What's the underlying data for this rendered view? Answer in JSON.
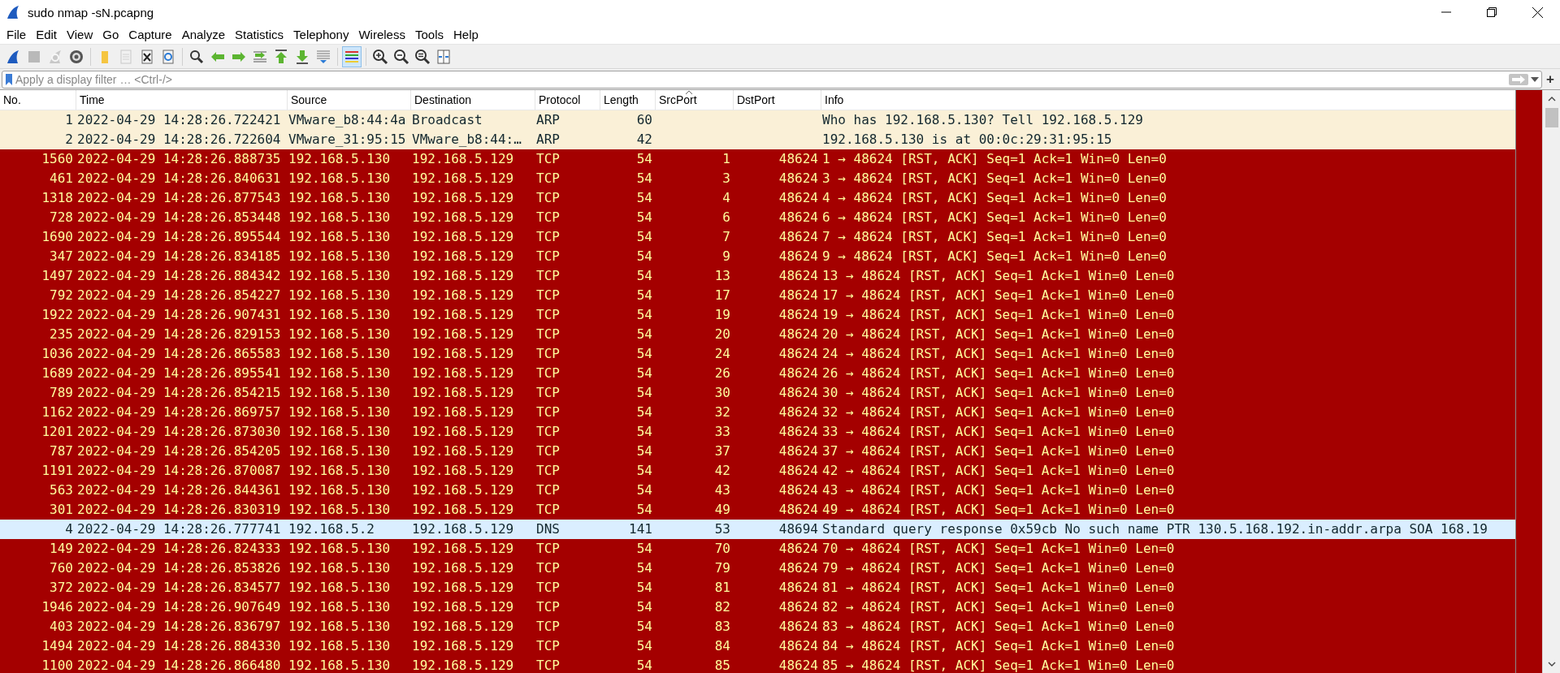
{
  "window": {
    "title": "sudo nmap -sN.pcapng"
  },
  "menu": [
    "File",
    "Edit",
    "View",
    "Go",
    "Capture",
    "Analyze",
    "Statistics",
    "Telephony",
    "Wireless",
    "Tools",
    "Help"
  ],
  "toolbar": [
    {
      "kind": "start",
      "disabled": false,
      "pressed": false
    },
    {
      "kind": "stop",
      "disabled": true,
      "pressed": false
    },
    {
      "kind": "restart",
      "disabled": true,
      "pressed": false
    },
    {
      "kind": "options",
      "disabled": false,
      "pressed": false
    },
    {
      "kind": "separator"
    },
    {
      "kind": "open",
      "disabled": false,
      "pressed": false
    },
    {
      "kind": "save",
      "disabled": true,
      "pressed": false
    },
    {
      "kind": "close",
      "disabled": false,
      "pressed": false
    },
    {
      "kind": "reload",
      "disabled": false,
      "pressed": false
    },
    {
      "kind": "separator"
    },
    {
      "kind": "find",
      "disabled": false,
      "pressed": false
    },
    {
      "kind": "back",
      "disabled": false,
      "pressed": false
    },
    {
      "kind": "forward",
      "disabled": false,
      "pressed": false
    },
    {
      "kind": "jump",
      "disabled": false,
      "pressed": false
    },
    {
      "kind": "first",
      "disabled": false,
      "pressed": false
    },
    {
      "kind": "last",
      "disabled": false,
      "pressed": false
    },
    {
      "kind": "autoscroll",
      "disabled": false,
      "pressed": false
    },
    {
      "kind": "separator"
    },
    {
      "kind": "colorize",
      "disabled": false,
      "pressed": true
    },
    {
      "kind": "separator"
    },
    {
      "kind": "zoom_in",
      "disabled": false,
      "pressed": false
    },
    {
      "kind": "zoom_out",
      "disabled": false,
      "pressed": false
    },
    {
      "kind": "zoom_reset",
      "disabled": false,
      "pressed": false
    },
    {
      "kind": "resize",
      "disabled": false,
      "pressed": false
    }
  ],
  "filter": {
    "placeholder": "Apply a display filter … <Ctrl-/>",
    "add_button": "+"
  },
  "table": {
    "columns": [
      {
        "label": "No.",
        "sorted": false
      },
      {
        "label": "Time",
        "sorted": false
      },
      {
        "label": "Source",
        "sorted": false
      },
      {
        "label": "Destination",
        "sorted": false
      },
      {
        "label": "Protocol",
        "sorted": false
      },
      {
        "label": "Length",
        "sorted": false
      },
      {
        "label": "SrcPort",
        "sorted": true
      },
      {
        "label": "DstPort",
        "sorted": false
      },
      {
        "label": "Info",
        "sorted": false
      }
    ],
    "rows": [
      {
        "kind": "arp",
        "no": "1",
        "time": "2022-04-29 14:28:26.722421",
        "source": "VMware_b8:44:4a",
        "destination": "Broadcast",
        "protocol": "ARP",
        "length": "60",
        "info": "Who has 192.168.5.130? Tell 192.168.5.129"
      },
      {
        "kind": "arp",
        "no": "2",
        "time": "2022-04-29 14:28:26.722604",
        "source": "VMware_31:95:15",
        "destination": "VMware_b8:44:…",
        "protocol": "ARP",
        "length": "42",
        "info": "192.168.5.130 is at 00:0c:29:31:95:15"
      },
      {
        "kind": "tcp_rst",
        "no": "1560",
        "time": "2022-04-29 14:28:26.888735",
        "source": "192.168.5.130",
        "destination": "192.168.5.129",
        "protocol": "TCP",
        "length": "54",
        "src_port": "1",
        "dst_port": "48624",
        "info": "1 → 48624 [RST, ACK] Seq=1 Ack=1 Win=0 Len=0"
      },
      {
        "kind": "tcp_rst",
        "no": "461",
        "time": "2022-04-29 14:28:26.840631",
        "source": "192.168.5.130",
        "destination": "192.168.5.129",
        "protocol": "TCP",
        "length": "54",
        "src_port": "3",
        "dst_port": "48624",
        "info": "3 → 48624 [RST, ACK] Seq=1 Ack=1 Win=0 Len=0"
      },
      {
        "kind": "tcp_rst",
        "no": "1318",
        "time": "2022-04-29 14:28:26.877543",
        "source": "192.168.5.130",
        "destination": "192.168.5.129",
        "protocol": "TCP",
        "length": "54",
        "src_port": "4",
        "dst_port": "48624",
        "info": "4 → 48624 [RST, ACK] Seq=1 Ack=1 Win=0 Len=0"
      },
      {
        "kind": "tcp_rst",
        "no": "728",
        "time": "2022-04-29 14:28:26.853448",
        "source": "192.168.5.130",
        "destination": "192.168.5.129",
        "protocol": "TCP",
        "length": "54",
        "src_port": "6",
        "dst_port": "48624",
        "info": "6 → 48624 [RST, ACK] Seq=1 Ack=1 Win=0 Len=0"
      },
      {
        "kind": "tcp_rst",
        "no": "1690",
        "time": "2022-04-29 14:28:26.895544",
        "source": "192.168.5.130",
        "destination": "192.168.5.129",
        "protocol": "TCP",
        "length": "54",
        "src_port": "7",
        "dst_port": "48624",
        "info": "7 → 48624 [RST, ACK] Seq=1 Ack=1 Win=0 Len=0"
      },
      {
        "kind": "tcp_rst",
        "no": "347",
        "time": "2022-04-29 14:28:26.834185",
        "source": "192.168.5.130",
        "destination": "192.168.5.129",
        "protocol": "TCP",
        "length": "54",
        "src_port": "9",
        "dst_port": "48624",
        "info": "9 → 48624 [RST, ACK] Seq=1 Ack=1 Win=0 Len=0"
      },
      {
        "kind": "tcp_rst",
        "no": "1497",
        "time": "2022-04-29 14:28:26.884342",
        "source": "192.168.5.130",
        "destination": "192.168.5.129",
        "protocol": "TCP",
        "length": "54",
        "src_port": "13",
        "dst_port": "48624",
        "info": "13 → 48624 [RST, ACK] Seq=1 Ack=1 Win=0 Len=0"
      },
      {
        "kind": "tcp_rst",
        "no": "792",
        "time": "2022-04-29 14:28:26.854227",
        "source": "192.168.5.130",
        "destination": "192.168.5.129",
        "protocol": "TCP",
        "length": "54",
        "src_port": "17",
        "dst_port": "48624",
        "info": "17 → 48624 [RST, ACK] Seq=1 Ack=1 Win=0 Len=0"
      },
      {
        "kind": "tcp_rst",
        "no": "1922",
        "time": "2022-04-29 14:28:26.907431",
        "source": "192.168.5.130",
        "destination": "192.168.5.129",
        "protocol": "TCP",
        "length": "54",
        "src_port": "19",
        "dst_port": "48624",
        "info": "19 → 48624 [RST, ACK] Seq=1 Ack=1 Win=0 Len=0"
      },
      {
        "kind": "tcp_rst",
        "no": "235",
        "time": "2022-04-29 14:28:26.829153",
        "source": "192.168.5.130",
        "destination": "192.168.5.129",
        "protocol": "TCP",
        "length": "54",
        "src_port": "20",
        "dst_port": "48624",
        "info": "20 → 48624 [RST, ACK] Seq=1 Ack=1 Win=0 Len=0"
      },
      {
        "kind": "tcp_rst",
        "no": "1036",
        "time": "2022-04-29 14:28:26.865583",
        "source": "192.168.5.130",
        "destination": "192.168.5.129",
        "protocol": "TCP",
        "length": "54",
        "src_port": "24",
        "dst_port": "48624",
        "info": "24 → 48624 [RST, ACK] Seq=1 Ack=1 Win=0 Len=0"
      },
      {
        "kind": "tcp_rst",
        "no": "1689",
        "time": "2022-04-29 14:28:26.895541",
        "source": "192.168.5.130",
        "destination": "192.168.5.129",
        "protocol": "TCP",
        "length": "54",
        "src_port": "26",
        "dst_port": "48624",
        "info": "26 → 48624 [RST, ACK] Seq=1 Ack=1 Win=0 Len=0"
      },
      {
        "kind": "tcp_rst",
        "no": "789",
        "time": "2022-04-29 14:28:26.854215",
        "source": "192.168.5.130",
        "destination": "192.168.5.129",
        "protocol": "TCP",
        "length": "54",
        "src_port": "30",
        "dst_port": "48624",
        "info": "30 → 48624 [RST, ACK] Seq=1 Ack=1 Win=0 Len=0"
      },
      {
        "kind": "tcp_rst",
        "no": "1162",
        "time": "2022-04-29 14:28:26.869757",
        "source": "192.168.5.130",
        "destination": "192.168.5.129",
        "protocol": "TCP",
        "length": "54",
        "src_port": "32",
        "dst_port": "48624",
        "info": "32 → 48624 [RST, ACK] Seq=1 Ack=1 Win=0 Len=0"
      },
      {
        "kind": "tcp_rst",
        "no": "1201",
        "time": "2022-04-29 14:28:26.873030",
        "source": "192.168.5.130",
        "destination": "192.168.5.129",
        "protocol": "TCP",
        "length": "54",
        "src_port": "33",
        "dst_port": "48624",
        "info": "33 → 48624 [RST, ACK] Seq=1 Ack=1 Win=0 Len=0"
      },
      {
        "kind": "tcp_rst",
        "no": "787",
        "time": "2022-04-29 14:28:26.854205",
        "source": "192.168.5.130",
        "destination": "192.168.5.129",
        "protocol": "TCP",
        "length": "54",
        "src_port": "37",
        "dst_port": "48624",
        "info": "37 → 48624 [RST, ACK] Seq=1 Ack=1 Win=0 Len=0"
      },
      {
        "kind": "tcp_rst",
        "no": "1191",
        "time": "2022-04-29 14:28:26.870087",
        "source": "192.168.5.130",
        "destination": "192.168.5.129",
        "protocol": "TCP",
        "length": "54",
        "src_port": "42",
        "dst_port": "48624",
        "info": "42 → 48624 [RST, ACK] Seq=1 Ack=1 Win=0 Len=0"
      },
      {
        "kind": "tcp_rst",
        "no": "563",
        "time": "2022-04-29 14:28:26.844361",
        "source": "192.168.5.130",
        "destination": "192.168.5.129",
        "protocol": "TCP",
        "length": "54",
        "src_port": "43",
        "dst_port": "48624",
        "info": "43 → 48624 [RST, ACK] Seq=1 Ack=1 Win=0 Len=0"
      },
      {
        "kind": "tcp_rst",
        "no": "301",
        "time": "2022-04-29 14:28:26.830319",
        "source": "192.168.5.130",
        "destination": "192.168.5.129",
        "protocol": "TCP",
        "length": "54",
        "src_port": "49",
        "dst_port": "48624",
        "info": "49 → 48624 [RST, ACK] Seq=1 Ack=1 Win=0 Len=0"
      },
      {
        "kind": "dns",
        "no": "4",
        "time": "2022-04-29 14:28:26.777741",
        "source": "192.168.5.2",
        "destination": "192.168.5.129",
        "protocol": "DNS",
        "length": "141",
        "src_port": "53",
        "dst_port": "48694",
        "info": "Standard query response 0x59cb No such name PTR 130.5.168.192.in-addr.arpa SOA 168.19"
      },
      {
        "kind": "tcp_rst",
        "no": "149",
        "time": "2022-04-29 14:28:26.824333",
        "source": "192.168.5.130",
        "destination": "192.168.5.129",
        "protocol": "TCP",
        "length": "54",
        "src_port": "70",
        "dst_port": "48624",
        "info": "70 → 48624 [RST, ACK] Seq=1 Ack=1 Win=0 Len=0"
      },
      {
        "kind": "tcp_rst",
        "no": "760",
        "time": "2022-04-29 14:28:26.853826",
        "source": "192.168.5.130",
        "destination": "192.168.5.129",
        "protocol": "TCP",
        "length": "54",
        "src_port": "79",
        "dst_port": "48624",
        "info": "79 → 48624 [RST, ACK] Seq=1 Ack=1 Win=0 Len=0"
      },
      {
        "kind": "tcp_rst",
        "no": "372",
        "time": "2022-04-29 14:28:26.834577",
        "source": "192.168.5.130",
        "destination": "192.168.5.129",
        "protocol": "TCP",
        "length": "54",
        "src_port": "81",
        "dst_port": "48624",
        "info": "81 → 48624 [RST, ACK] Seq=1 Ack=1 Win=0 Len=0"
      },
      {
        "kind": "tcp_rst",
        "no": "1946",
        "time": "2022-04-29 14:28:26.907649",
        "source": "192.168.5.130",
        "destination": "192.168.5.129",
        "protocol": "TCP",
        "length": "54",
        "src_port": "82",
        "dst_port": "48624",
        "info": "82 → 48624 [RST, ACK] Seq=1 Ack=1 Win=0 Len=0"
      },
      {
        "kind": "tcp_rst",
        "no": "403",
        "time": "2022-04-29 14:28:26.836797",
        "source": "192.168.5.130",
        "destination": "192.168.5.129",
        "protocol": "TCP",
        "length": "54",
        "src_port": "83",
        "dst_port": "48624",
        "info": "83 → 48624 [RST, ACK] Seq=1 Ack=1 Win=0 Len=0"
      },
      {
        "kind": "tcp_rst",
        "no": "1494",
        "time": "2022-04-29 14:28:26.884330",
        "source": "192.168.5.130",
        "destination": "192.168.5.129",
        "protocol": "TCP",
        "length": "54",
        "src_port": "84",
        "dst_port": "48624",
        "info": "84 → 48624 [RST, ACK] Seq=1 Ack=1 Win=0 Len=0"
      },
      {
        "kind": "tcp_rst",
        "no": "1100",
        "time": "2022-04-29 14:28:26.866480",
        "source": "192.168.5.130",
        "destination": "192.168.5.129",
        "protocol": "TCP",
        "length": "54",
        "src_port": "85",
        "dst_port": "48624",
        "info": "85 → 48624 [RST, ACK] Seq=1 Ack=1 Win=0 Len=0"
      }
    ]
  }
}
